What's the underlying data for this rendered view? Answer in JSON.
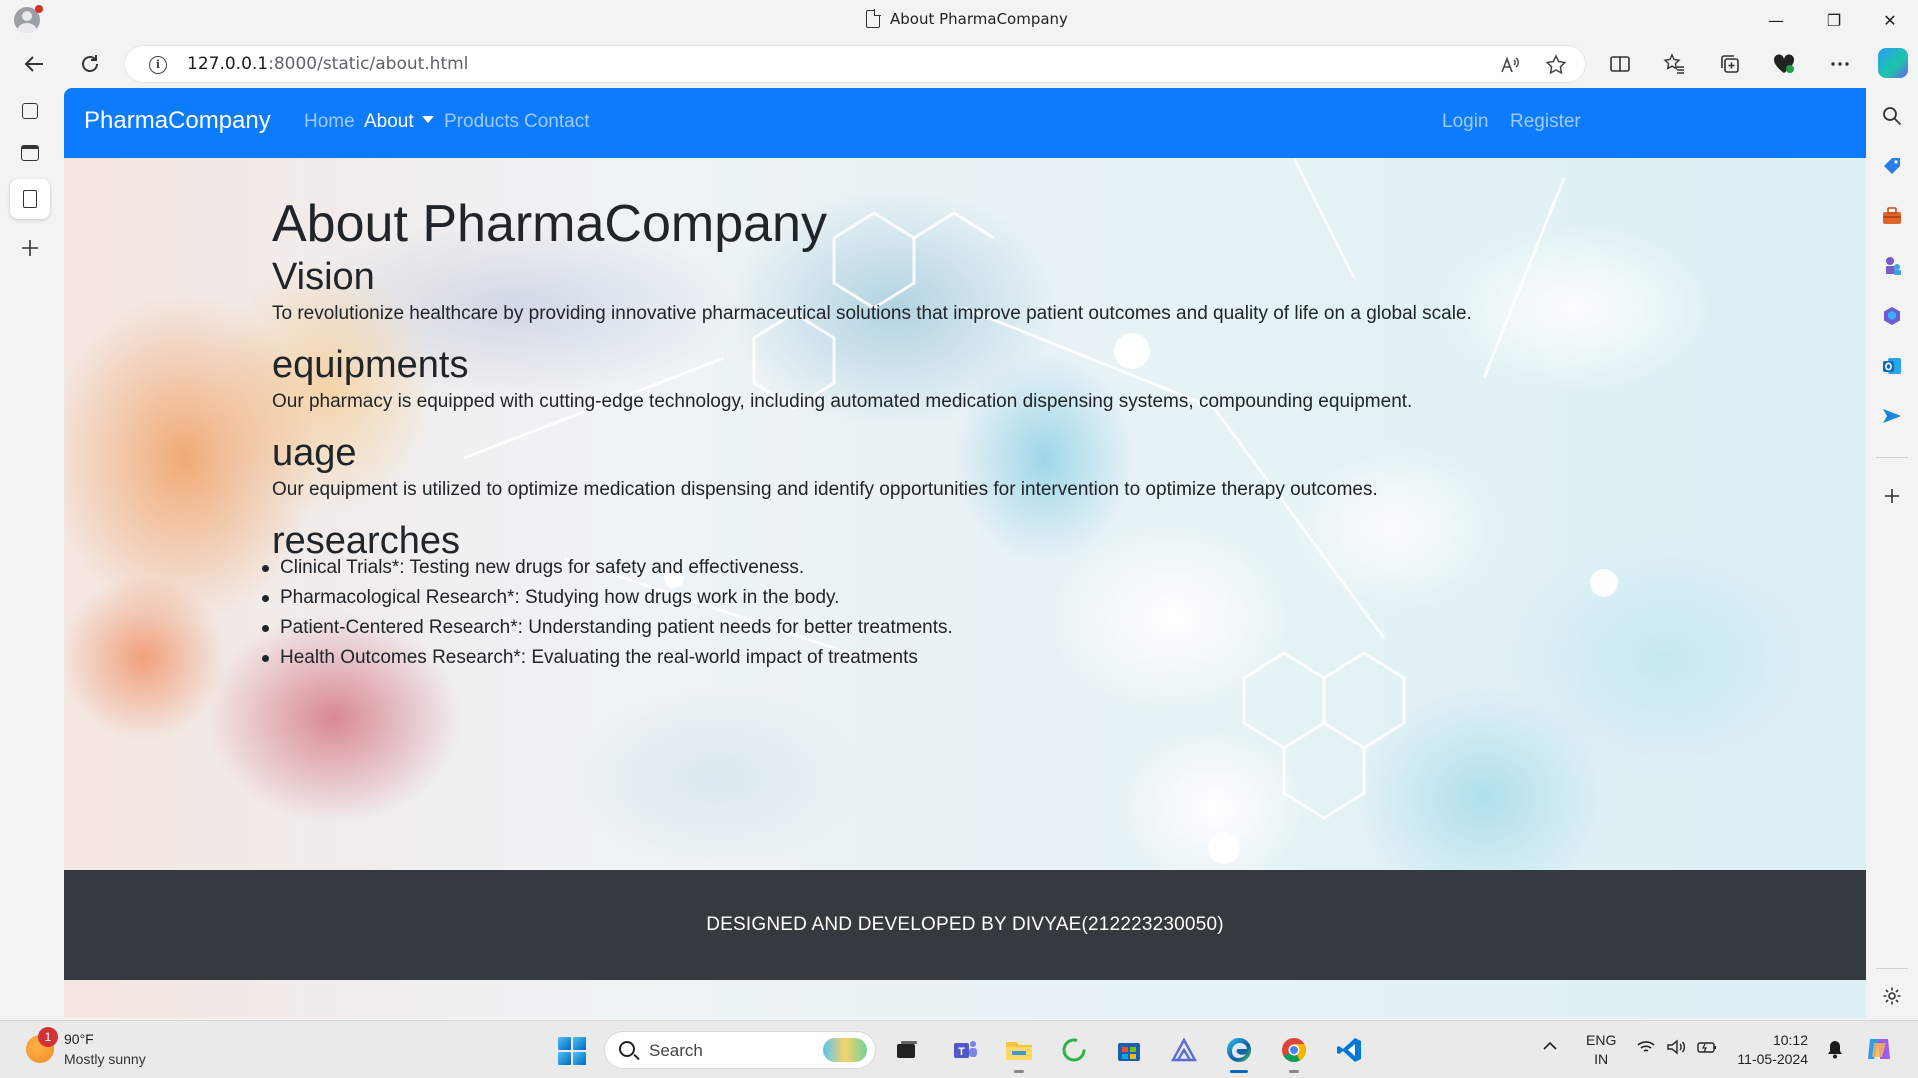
{
  "browser": {
    "tab_title": "About PharmaCompany",
    "url_host": "127.0.0.1",
    "url_path": ":8000/static/about.html",
    "minimize": "—",
    "restore": "❐",
    "close": "✕"
  },
  "navbar": {
    "brand": "PharmaCompany",
    "links": [
      "Home",
      "About",
      "Products",
      "Contact"
    ],
    "right_links": [
      "Login",
      "Register"
    ],
    "color": "#0d7bfd"
  },
  "page": {
    "title": "About PharmaCompany",
    "sections": [
      {
        "heading": "Vision",
        "text": "To revolutionize healthcare by providing innovative pharmaceutical solutions that improve patient outcomes and quality of life on a global scale."
      },
      {
        "heading": "equipments",
        "text": "Our pharmacy is equipped with cutting-edge technology, including automated medication dispensing systems, compounding equipment."
      },
      {
        "heading": "uage",
        "text": "Our equipment is utilized to optimize medication dispensing and identify opportunities for intervention to optimize therapy outcomes."
      },
      {
        "heading": "researches"
      }
    ],
    "research_items": [
      "Clinical Trials*: Testing new drugs for safety and effectiveness.",
      "Pharmacological Research*: Studying how drugs work in the body.",
      "Patient-Centered Research*: Understanding patient needs for better treatments.",
      "Health Outcomes Research*: Evaluating the real-world impact of treatments"
    ]
  },
  "footer": {
    "text": "DESIGNED AND DEVELOPED BY DIVYAE(212223230050)",
    "color": "#343a40"
  },
  "taskbar": {
    "weather_badge": "1",
    "weather_temp": "90°F",
    "weather_desc": "Mostly sunny",
    "search_label": "Search",
    "lang_1": "ENG",
    "lang_2": "IN",
    "time": "10:12",
    "date": "11-05-2024"
  }
}
